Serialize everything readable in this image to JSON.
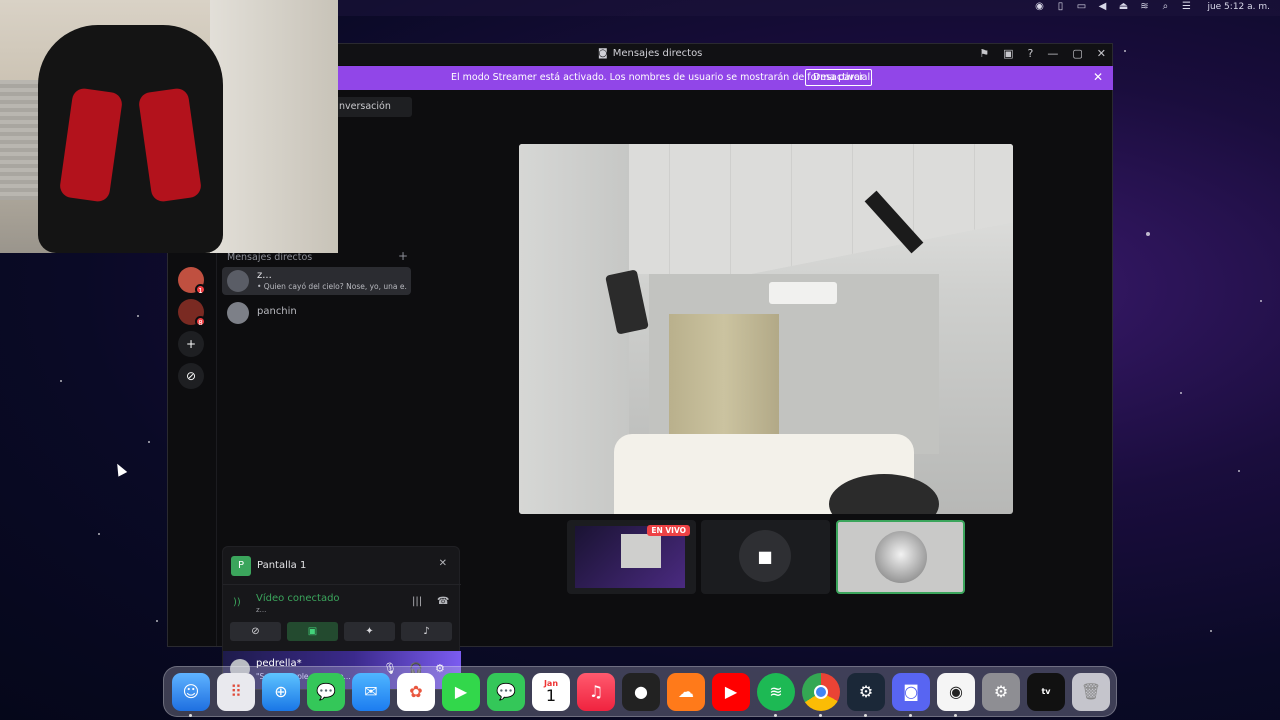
{
  "menubar": {
    "icons": [
      "user-circle-icon",
      "battery-icon",
      "display-icon",
      "volume-icon",
      "eject-icon",
      "wifi-icon",
      "search-icon",
      "control-center-icon"
    ],
    "clock": "jue 5:12 a. m."
  },
  "window": {
    "title": "Mensajes directos",
    "streamer_banner": {
      "message": "El modo Streamer está activado. Los nombres de usuario se mostrarán de forma parcial.",
      "button": "Desactivar"
    },
    "search": {
      "label": "nversación"
    },
    "dm_header": "Mensajes directos",
    "dm_plus": "+",
    "servers": [
      {
        "badge": "1"
      },
      {
        "badge": "8"
      }
    ],
    "dms": [
      {
        "name": "z...",
        "preview": "• Quien cayó del cielo? Nose, yo, una e..."
      },
      {
        "name": "panchin"
      }
    ],
    "voice": {
      "title": "Pantalla 1",
      "status": "Vídeo conectado",
      "channel_user": "z..."
    },
    "user": {
      "name": "pedrella*",
      "status": "\"Some people are simp..."
    }
  },
  "thumbnails": {
    "live_badge": "EN VIVO"
  },
  "dock": {
    "apps": [
      "Finder",
      "Launchpad",
      "Safari",
      "Messages",
      "Mail",
      "Photos",
      "FaceTime",
      "Messages",
      "Calendar",
      "Music",
      "Apple TV Remote",
      "SoundCloud",
      "YouTube",
      "Spotify",
      "Chrome",
      "Steam",
      "Discord",
      "OBS",
      "System Settings",
      "Apple TV",
      "Trash"
    ],
    "calendar": {
      "month": "Jan",
      "day": "1"
    },
    "tv_label": "tv"
  }
}
